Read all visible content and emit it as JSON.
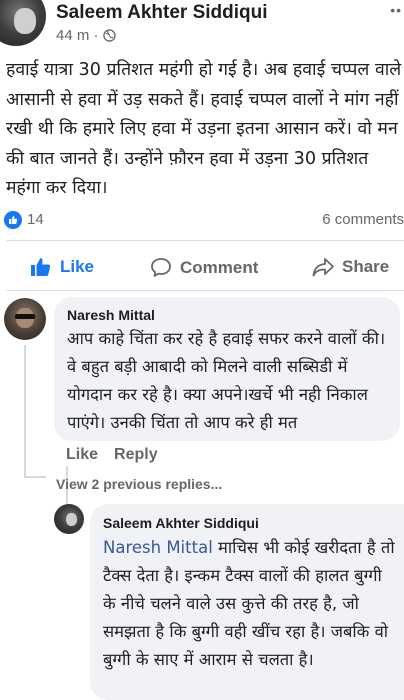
{
  "post": {
    "author": "Saleem Akhter Siddiqui",
    "time": "44 m ·",
    "text": "हवाई यात्रा 30 प्रतिशत महंगी हो गई है। अब हवाई चप्पल वाले आसानी से हवा में उड़ सकते हैं। हवाई चप्पल वालों ने मांग नहीं रखी थी कि हमारे लिए हवा में उड़ना इतना आसान करें। वो मन की बात जानते हैं। उन्होंने फ़ौरन हवा में उड़ना 30 प्रतिशत महंगा कर दिया।",
    "likes": "14",
    "comments": "6 comments"
  },
  "actions": {
    "like": "Like",
    "comment": "Comment",
    "share": "Share"
  },
  "comment1": {
    "author": "Naresh Mittal",
    "text": "आप काहे चिंता कर रहे है हवाई सफर करने वालों की। वे बहुत बड़ी आबादी को मिलने वाली सब्सिडी में योगदान कर रहे है। क्या अपने।खर्चे भी नही निकाल पाएंगे। उनकी चिंता तो आप करे ही मत",
    "like_label": "Like",
    "reply_label": "Reply"
  },
  "view_previous": "View 2 previous replies...",
  "reply1": {
    "author": "Saleem Akhter Siddiqui",
    "mention": "Naresh Mittal",
    "text": " माचिस भी कोई खरीदता है तो टैक्स देता है। इन्कम टैक्स वालों की हालत बुग्गी के नीचे चलने वाले उस कुत्ते की तरह है, जो समझता है कि बुग्गी वही खींच रहा है। जबकि वो बुग्गी के साए में आराम से चलता है।"
  },
  "colors": {
    "accent": "#1877f2",
    "mention": "#385898",
    "muted": "#65676b",
    "bubble": "#f0f2f5"
  },
  "icons": [
    "globe-icon",
    "more-icon",
    "like-badge-icon",
    "thumbs-up-icon",
    "comment-icon",
    "share-icon"
  ]
}
